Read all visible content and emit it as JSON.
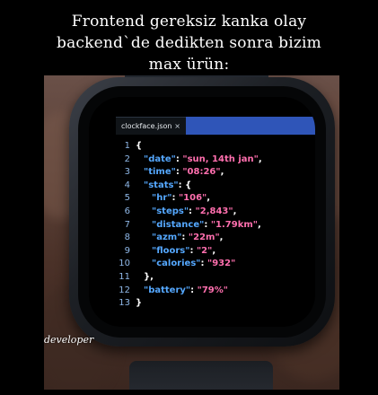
{
  "caption": {
    "line1": "Frontend gereksiz kanka olay",
    "line2": "backend`de dedikten sonra bizim",
    "line3": "max ürün:"
  },
  "editor": {
    "tab_label": "clockface.json",
    "tab_close": "×",
    "lines": [
      {
        "num": "1",
        "text": "{"
      },
      {
        "num": "2",
        "text": "\"date\": \"sun, 14th jan\","
      },
      {
        "num": "3",
        "text": "\"time\": \"08:26\","
      },
      {
        "num": "4",
        "text": "\"stats\": {"
      },
      {
        "num": "5",
        "text": "\"hr\": \"106\","
      },
      {
        "num": "6",
        "text": "\"steps\": \"2,843\","
      },
      {
        "num": "7",
        "text": "\"distance\": \"1.79km\","
      },
      {
        "num": "8",
        "text": "\"azm\": \"22m\","
      },
      {
        "num": "9",
        "text": "\"floors\": \"2\","
      },
      {
        "num": "10",
        "text": "\"calories\": \"932\""
      },
      {
        "num": "11",
        "text": "},"
      },
      {
        "num": "12",
        "text": "\"battery\": \"79%\""
      },
      {
        "num": "13",
        "text": "}"
      }
    ]
  },
  "watermark": "developer",
  "colors": {
    "key": "#55a8ff",
    "value": "#ff6fae",
    "punct": "#ffffff",
    "line_number": "#8fb8e8",
    "tab_accent": "#2f55b8"
  }
}
